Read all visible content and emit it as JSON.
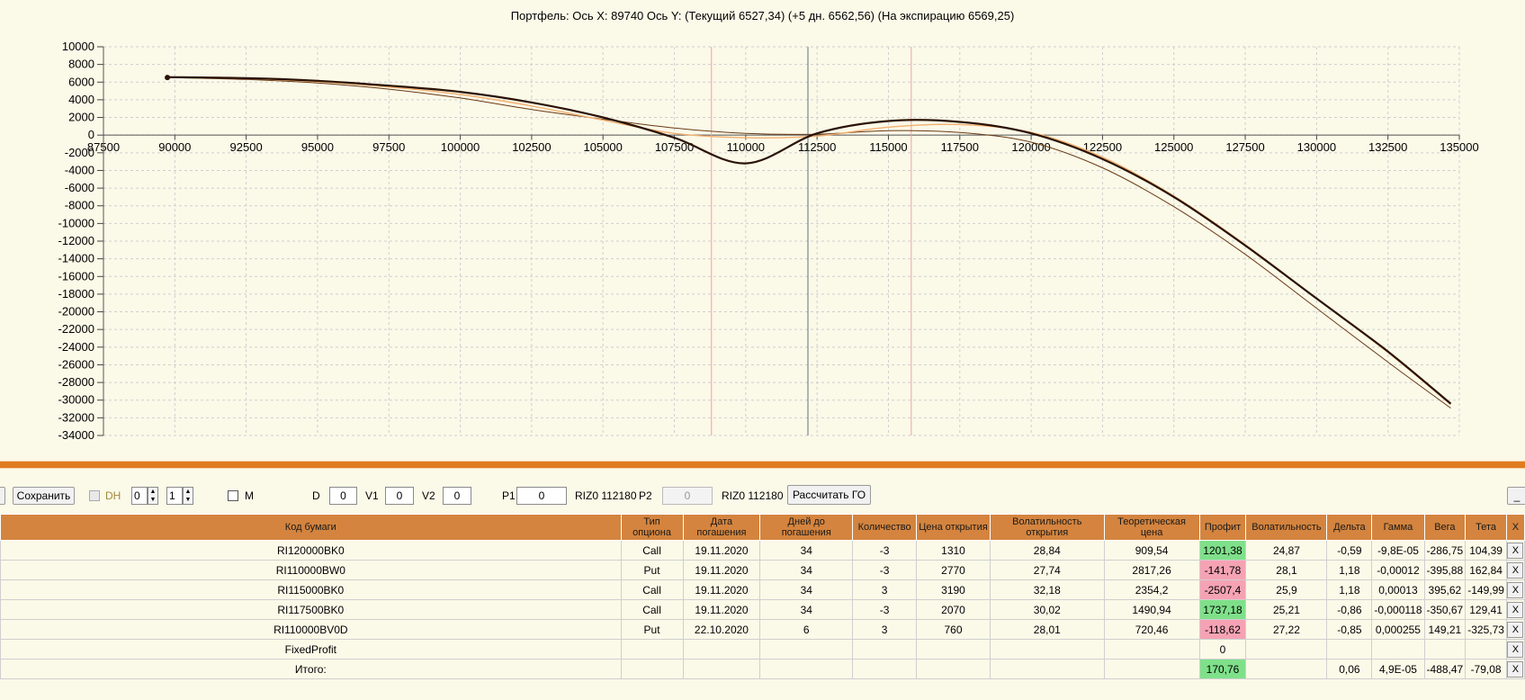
{
  "chart_title": "Портфель: Ось X: 89740 Ось Y:  (Текущий 6527,34)  (+5 дн. 6562,56)  (На экспирацию 6569,25)",
  "chart_data": {
    "type": "line",
    "title": "Портфель: Ось X: 89740 Ось Y:  (Текущий 6527,34)  (+5 дн. 6562,56)  (На экспирацию 6569,25)",
    "xlim": [
      87500,
      135000
    ],
    "ylim": [
      -34000,
      10000
    ],
    "x_ticks": [
      87500,
      90000,
      92500,
      95000,
      97500,
      100000,
      102500,
      105000,
      107500,
      110000,
      112500,
      115000,
      117500,
      120000,
      122500,
      125000,
      127500,
      130000,
      132500,
      135000
    ],
    "y_ticks": [
      10000,
      8000,
      6000,
      4000,
      2000,
      0,
      -2000,
      -4000,
      -6000,
      -8000,
      -10000,
      -12000,
      -14000,
      -16000,
      -18000,
      -20000,
      -22000,
      -24000,
      -26000,
      -28000,
      -30000,
      -32000,
      -34000
    ],
    "grid": true,
    "current_marker": {
      "x": 89740,
      "y": 6527.34
    },
    "vertical_lines": [
      {
        "x": 108800,
        "color": "#f0a0a0"
      },
      {
        "x": 112180,
        "color": "#607080"
      },
      {
        "x": 115800,
        "color": "#f0a0a0"
      }
    ],
    "series": [
      {
        "color": "#2a1204",
        "width": 2.2,
        "x": [
          89740,
          92500,
          95000,
          97500,
          100000,
          102500,
          105000,
          107500,
          110000,
          112500,
          115000,
          117500,
          120000,
          122500,
          125000,
          127500,
          130000,
          132500,
          134700
        ],
        "values": [
          6569,
          6450,
          6150,
          5600,
          4900,
          3700,
          2000,
          -300,
          -3200,
          200,
          1600,
          1500,
          200,
          -2700,
          -7000,
          -12500,
          -18500,
          -24500,
          -30400
        ]
      },
      {
        "color": "#f3b070",
        "width": 1.4,
        "x": [
          89740,
          92500,
          95000,
          97500,
          100000,
          102500,
          105000,
          107500,
          110000,
          112500,
          115000,
          117500,
          120000,
          122500,
          125000,
          127500,
          130000,
          132500,
          134700
        ],
        "values": [
          6563,
          6400,
          6050,
          5450,
          4600,
          3300,
          1700,
          200,
          -300,
          -100,
          900,
          1200,
          300,
          -2500,
          -6900,
          -12400,
          -18500,
          -24600,
          -30500
        ]
      },
      {
        "color": "#6a3a14",
        "width": 1.0,
        "x": [
          89740,
          92500,
          95000,
          97500,
          100000,
          102500,
          105000,
          107500,
          110000,
          112500,
          115000,
          117500,
          120000,
          122500,
          125000,
          127500,
          130000,
          132500,
          134700
        ],
        "values": [
          6527,
          6300,
          5900,
          5200,
          4200,
          2900,
          1800,
          800,
          200,
          100,
          500,
          300,
          -800,
          -3700,
          -8100,
          -13500,
          -19600,
          -25700,
          -30900
        ]
      }
    ]
  },
  "toolbar": {
    "save_label": "Сохранить",
    "dh_label": "DH",
    "spin1_value": "0",
    "spin2_value": "1",
    "m_label": "M",
    "d_label": "D",
    "d_value": "0",
    "v1_label": "V1",
    "v1_value": "0",
    "v2_label": "V2",
    "v2_value": "0",
    "p1_label": "P1",
    "p1_value": "0",
    "p1_instrument": "RIZ0 112180",
    "p2_label": "P2",
    "p2_value": "0",
    "p2_instrument": "RIZ0 112180",
    "calc_label": "Рассчитать ГО",
    "minimize_label": "_"
  },
  "table": {
    "headers": [
      "Код бумаги",
      "Тип опциона",
      "Дата погашения",
      "Дней до погашения",
      "Количество",
      "Цена открытия",
      "Волатильность открытия",
      "Теоретическая цена",
      "Профит",
      "Волатильность",
      "Дельта",
      "Гамма",
      "Вега",
      "Тета",
      "X"
    ],
    "rows": [
      [
        "RI120000BK0",
        "Call",
        "19.11.2020",
        "34",
        "-3",
        "1310",
        "28,84",
        "909,54",
        "1201,38",
        "24,87",
        "-0,59",
        "-9,8E-05",
        "-286,75",
        "104,39",
        "X"
      ],
      [
        "RI110000BW0",
        "Put",
        "19.11.2020",
        "34",
        "-3",
        "2770",
        "27,74",
        "2817,26",
        "-141,78",
        "28,1",
        "1,18",
        "-0,00012",
        "-395,88",
        "162,84",
        "X"
      ],
      [
        "RI115000BK0",
        "Call",
        "19.11.2020",
        "34",
        "3",
        "3190",
        "32,18",
        "2354,2",
        "-2507,4",
        "25,9",
        "1,18",
        "0,00013",
        "395,62",
        "-149,99",
        "X"
      ],
      [
        "RI117500BK0",
        "Call",
        "19.11.2020",
        "34",
        "-3",
        "2070",
        "30,02",
        "1490,94",
        "1737,18",
        "25,21",
        "-0,86",
        "-0,000118",
        "-350,67",
        "129,41",
        "X"
      ],
      [
        "RI110000BV0D",
        "Put",
        "22.10.2020",
        "6",
        "3",
        "760",
        "28,01",
        "720,46",
        "-118,62",
        "27,22",
        "-0,85",
        "0,000255",
        "149,21",
        "-325,73",
        "X"
      ],
      [
        "FixedProfit",
        "",
        "",
        "",
        "",
        "",
        "",
        "",
        "0",
        "",
        "",
        "",
        "",
        "",
        "X"
      ],
      [
        "Итого:",
        "",
        "",
        "",
        "",
        "",
        "",
        "",
        "170,76",
        "",
        "0,06",
        "4,9E-05",
        "-488,47",
        "-79,08",
        "X"
      ]
    ],
    "profit_status": [
      "pos",
      "neg",
      "neg",
      "pos",
      "neg",
      "none",
      "pos"
    ],
    "colors": {
      "header": "#d4843e",
      "positive": "#7fe08a",
      "negative": "#f5a3b4",
      "splitter": "#e07c1f"
    }
  }
}
